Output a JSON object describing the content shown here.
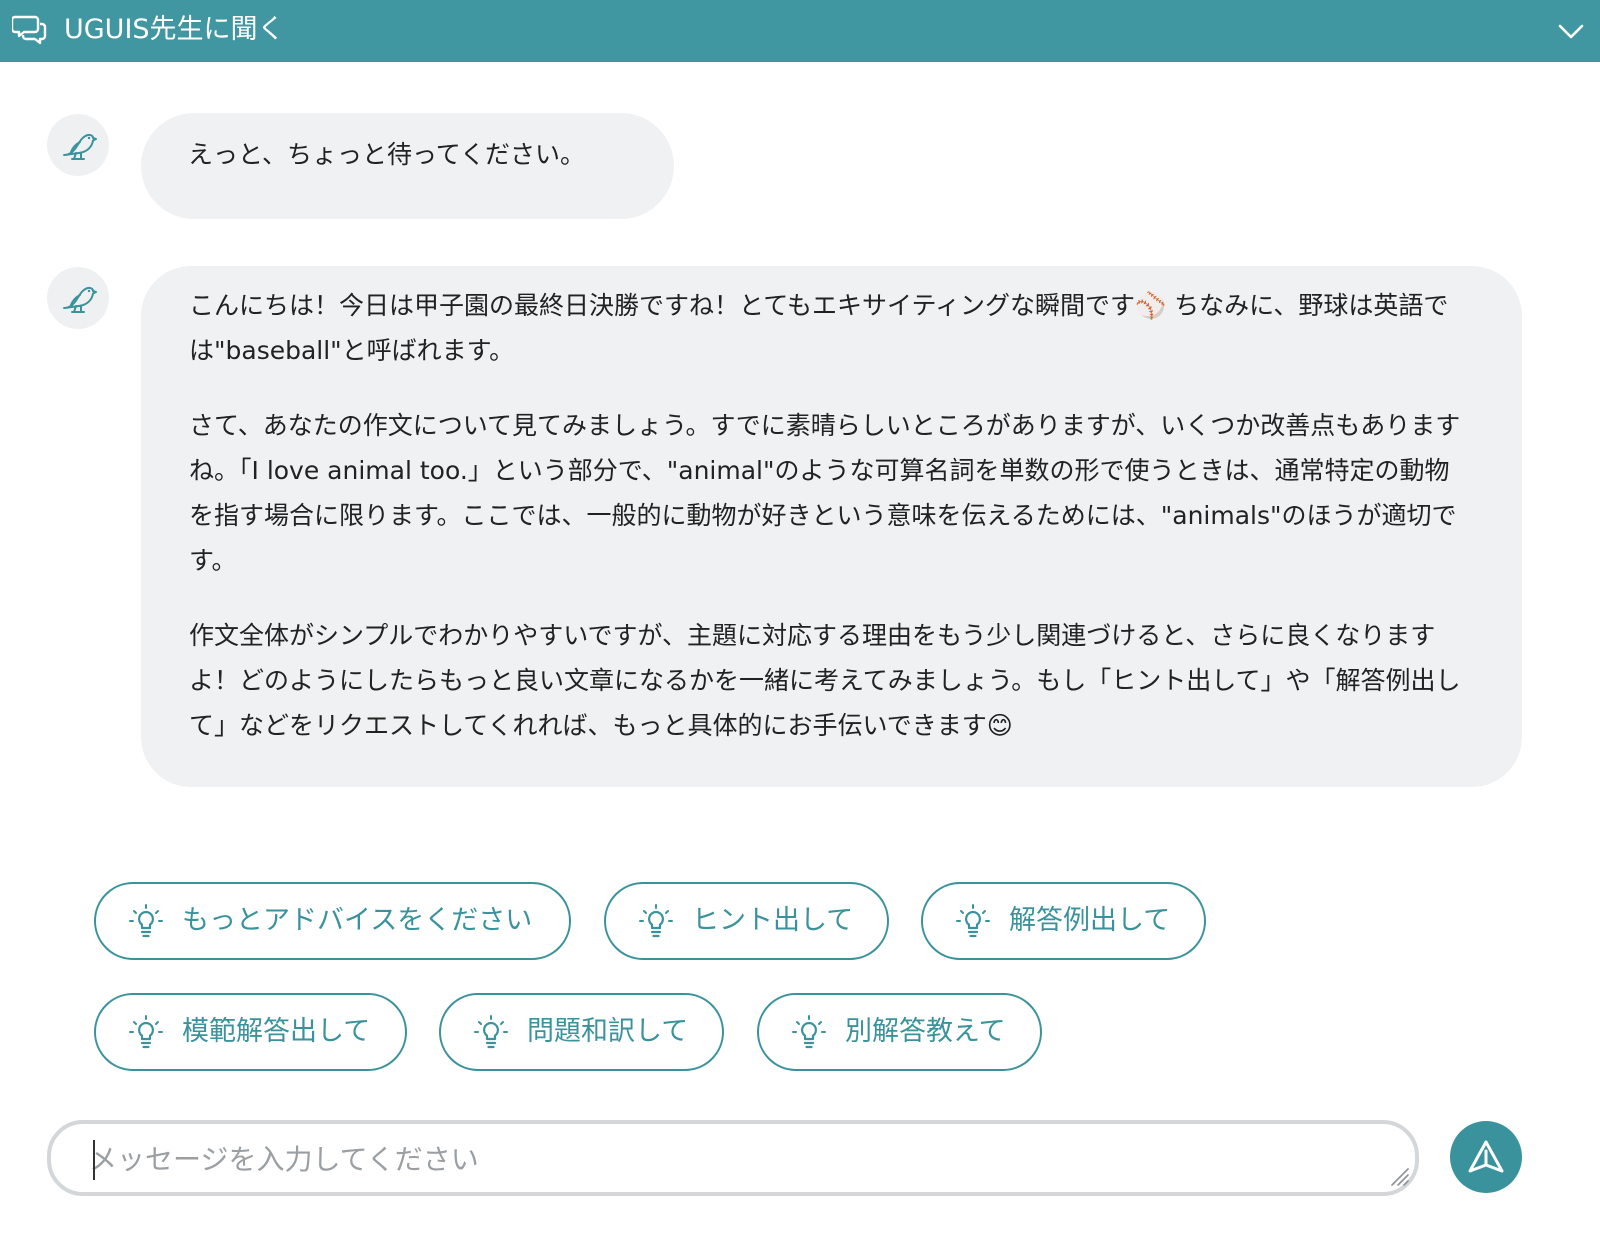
{
  "header": {
    "title": "UGUIS先生に聞く",
    "icons": {
      "left": "chat-bubbles-icon",
      "right": "chevron-down-icon"
    }
  },
  "messages": [
    {
      "sender_icon": "bird-icon",
      "paragraphs": [
        "えっと、ちょっと待ってください。"
      ]
    },
    {
      "sender_icon": "bird-icon",
      "paragraphs": [
        "こんにちは！今日は甲子園の最終日決勝ですね！とてもエキサイティングな瞬間です⚾ ちなみに、野球は英語では\"baseball\"と呼ばれます。",
        "さて、あなたの作文について見てみましょう。すでに素晴らしいところがありますが、いくつか改善点もありますね。「I love animal too.」という部分で、\"animal\"のような可算名詞を単数の形で使うときは、通常特定の動物を指す場合に限ります。ここでは、一般的に動物が好きという意味を伝えるためには、\"animals\"のほうが適切です。",
        "作文全体がシンプルでわかりやすいですが、主題に対応する理由をもう少し関連づけると、さらに良くなりますよ！どのようにしたらもっと良い文章になるかを一緒に考えてみましょう。もし「ヒント出して」や「解答例出して」などをリクエストしてくれれば、もっと具体的にお手伝いできます😊"
      ]
    }
  ],
  "suggestions": [
    {
      "label": "もっとアドバイスをください",
      "icon": "lightbulb-icon"
    },
    {
      "label": "ヒント出して",
      "icon": "lightbulb-icon"
    },
    {
      "label": "解答例出して",
      "icon": "lightbulb-icon"
    },
    {
      "label": "模範解答出して",
      "icon": "lightbulb-icon"
    },
    {
      "label": "問題和訳して",
      "icon": "lightbulb-icon"
    },
    {
      "label": "別解答教えて",
      "icon": "lightbulb-icon"
    }
  ],
  "composer": {
    "placeholder": "メッセージを入力してください",
    "value": "",
    "send_icon": "send-icon"
  },
  "colors": {
    "header_bg": "#4197a1",
    "accent": "#3a939c",
    "bubble_bg": "#f0f1f3",
    "avatar_bg": "#eef0f1",
    "input_border": "#d3d7da",
    "placeholder": "#9a9fa3"
  }
}
